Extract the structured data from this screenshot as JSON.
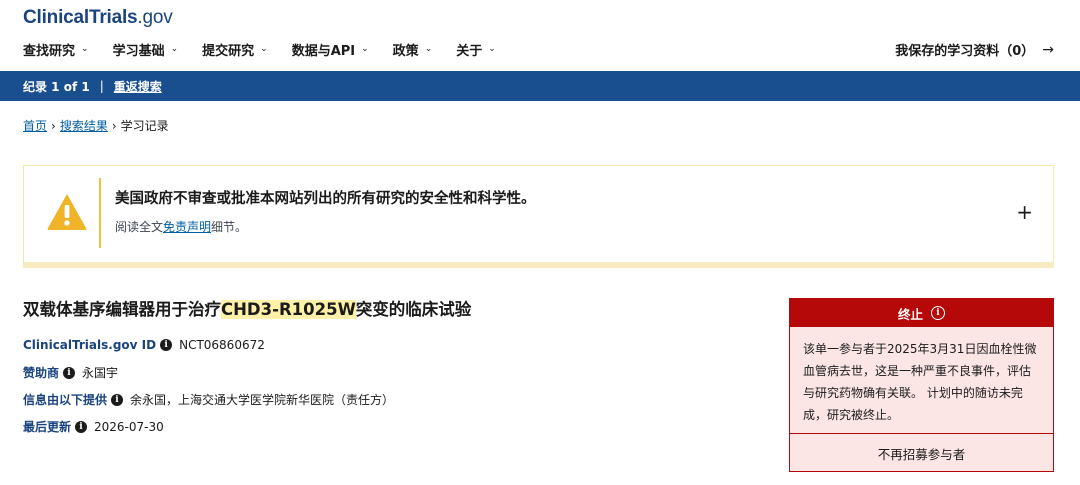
{
  "site": {
    "logo_main": "ClinicalTrials",
    "logo_tld": ".gov"
  },
  "nav": {
    "items": [
      {
        "label": "查找研究"
      },
      {
        "label": "学习基础"
      },
      {
        "label": "提交研究"
      },
      {
        "label": "数据与API"
      },
      {
        "label": "政策"
      },
      {
        "label": "关于"
      }
    ],
    "chevron": "⌄",
    "saved_label": "我保存的学习资料（0）",
    "saved_arrow": "→"
  },
  "record_bar": {
    "record_text": "纪录 1 of 1",
    "separator": "|",
    "back_search": "重返搜索"
  },
  "breadcrumb": {
    "home": "首页",
    "sep1": "›",
    "results": "搜索结果",
    "sep2": "›",
    "current": "学习记录"
  },
  "notice": {
    "title": "美国政府不审查或批准本网站列出的所有研究的安全性和科学性。",
    "sub_prefix": "阅读全文",
    "sub_link": "免责声明",
    "sub_suffix": "细节。",
    "expand": "+"
  },
  "study": {
    "title_prefix": "双载体基序编辑器用于治疗",
    "title_highlight": "CHD3-R1025W",
    "title_suffix": "突变的临床试验",
    "id_label": "ClinicalTrials.gov ID",
    "id_value": "NCT06860672",
    "sponsor_label": "赞助商",
    "sponsor_value": "永国宇",
    "provider_label": "信息由以下提供",
    "provider_value": "余永国，上海交通大学医学院新华医院（责任方）",
    "updated_label": "最后更新",
    "updated_value": "2026-07-30",
    "info_glyph": "i"
  },
  "status": {
    "label": "终止",
    "info_glyph": "i",
    "body": "该单一参与者于2025年3月31日因血栓性微血管病去世，这是一种严重不良事件，评估与研究药物确有关联。 计划中的随访未完成，研究被终止。",
    "footer": "不再招募参与者"
  },
  "colors": {
    "brand": "#1a4480",
    "bar": "#1a4f8f",
    "link": "#005ea2",
    "warn": "#f0b429",
    "status_red": "#b50909",
    "status_bg": "#fbe6e5",
    "highlight": "#fff1a8"
  }
}
